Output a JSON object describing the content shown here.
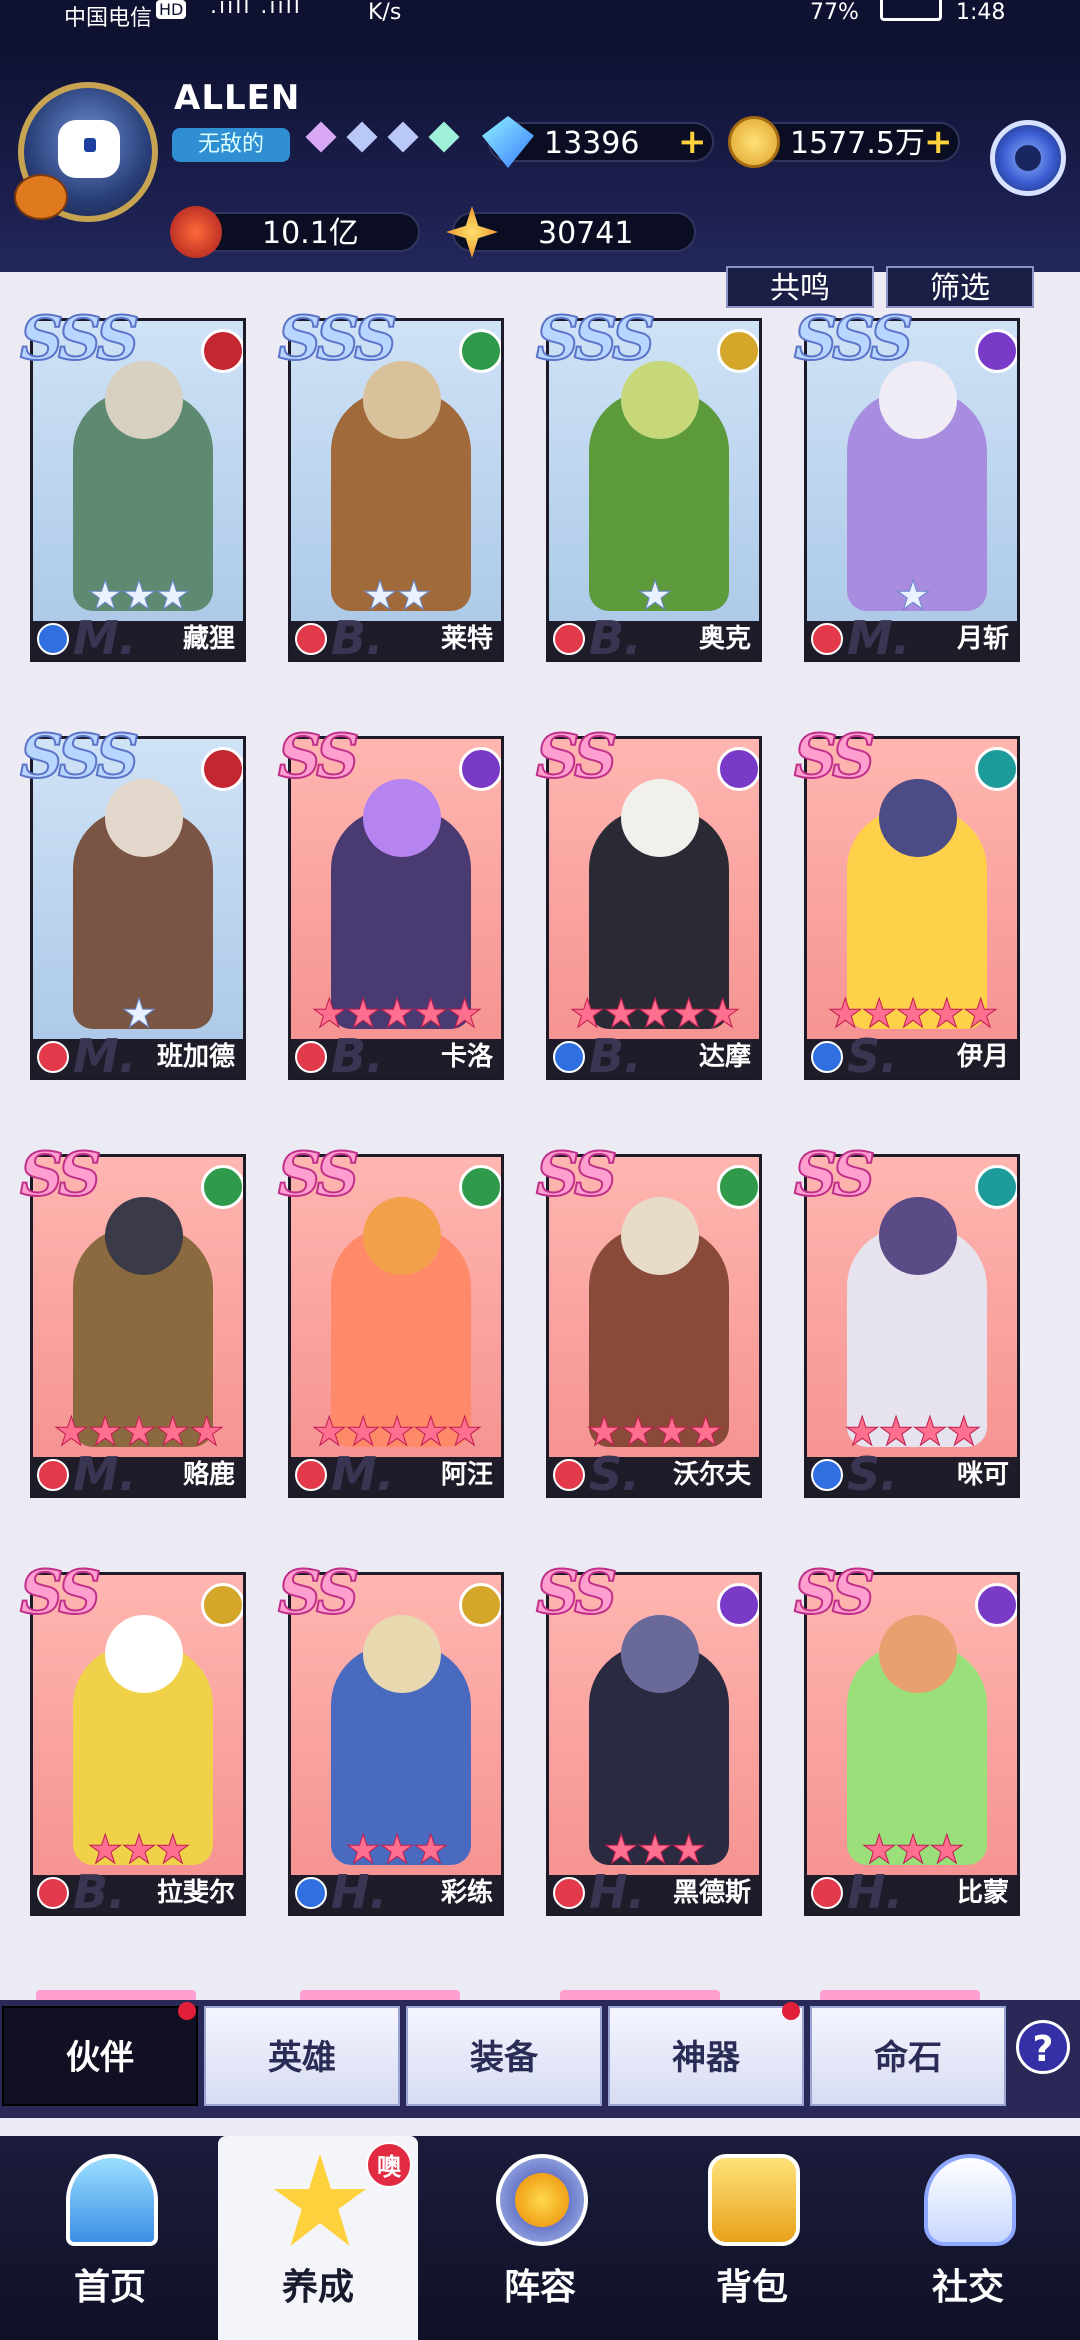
{
  "status_bar": {
    "carrier": "中国电信",
    "hd": "HD",
    "signal": ".ııll .ııll",
    "netspeed": "K/s",
    "battery": "77%",
    "time": "1:48"
  },
  "player": {
    "name": "ALLEN",
    "title": "无敌的"
  },
  "currency": {
    "diamonds": "13396",
    "gold": "1577.5万",
    "power": "10.1亿",
    "stardust": "30741"
  },
  "filters": {
    "resonance": "共鸣",
    "filter": "筛选"
  },
  "colors": {
    "accent": "#2f8fd2",
    "gold": "#ffd23d",
    "nav_bg": "#1b1c3c",
    "alert": "#e22a43"
  },
  "heroes": [
    {
      "name": "藏狸",
      "rank": "SSS",
      "stars": 3,
      "star_type": "white",
      "faction": "fire",
      "class": "M.",
      "role": "heart",
      "palette": [
        "#5f8a72",
        "#d8d0c0"
      ]
    },
    {
      "name": "莱特",
      "rank": "SSS",
      "stars": 2,
      "star_type": "white",
      "faction": "nature",
      "class": "B.",
      "role": "sword",
      "palette": [
        "#a06a3a",
        "#d9c29b"
      ]
    },
    {
      "name": "奥克",
      "rank": "SSS",
      "stars": 1,
      "star_type": "white",
      "faction": "light",
      "class": "B.",
      "role": "shield",
      "palette": [
        "#5d9a3b",
        "#c6d87a"
      ]
    },
    {
      "name": "月斩",
      "rank": "SSS",
      "stars": 1,
      "star_type": "white",
      "faction": "moon",
      "class": "M.",
      "role": "sword",
      "palette": [
        "#a88ce0",
        "#f0ecf6"
      ]
    },
    {
      "name": "班加德",
      "rank": "SSS",
      "stars": 1,
      "star_type": "white",
      "faction": "fire",
      "class": "M.",
      "role": "sword",
      "palette": [
        "#7b5543",
        "#e4d8cc"
      ]
    },
    {
      "name": "卡洛",
      "rank": "SS",
      "stars": 5,
      "star_type": "pink",
      "faction": "moon",
      "class": "B.",
      "role": "sword",
      "palette": [
        "#4a3a72",
        "#b684f0"
      ]
    },
    {
      "name": "达摩",
      "rank": "SS",
      "stars": 5,
      "star_type": "pink",
      "faction": "moon",
      "class": "B.",
      "role": "wand",
      "palette": [
        "#2a2a35",
        "#f2f0ec"
      ]
    },
    {
      "name": "伊月",
      "rank": "SS",
      "stars": 5,
      "star_type": "pink",
      "faction": "water",
      "class": "S.",
      "role": "heart",
      "palette": [
        "#ffd04a",
        "#4b4b86"
      ]
    },
    {
      "name": "赂鹿",
      "rank": "SS",
      "stars": 5,
      "star_type": "pink",
      "faction": "nature",
      "class": "M.",
      "role": "sword",
      "palette": [
        "#8a6a3e",
        "#3a3a48"
      ]
    },
    {
      "name": "阿汪",
      "rank": "SS",
      "stars": 5,
      "star_type": "pink",
      "faction": "nature",
      "class": "M.",
      "role": "shield",
      "palette": [
        "#ff8a6a",
        "#f2a04a"
      ]
    },
    {
      "name": "沃尔夫",
      "rank": "SS",
      "stars": 4,
      "star_type": "pink",
      "faction": "nature",
      "class": "S.",
      "role": "sword",
      "palette": [
        "#8a4a3a",
        "#e8dcc8"
      ]
    },
    {
      "name": "咪可",
      "rank": "SS",
      "stars": 4,
      "star_type": "pink",
      "faction": "water",
      "class": "S.",
      "role": "wand",
      "palette": [
        "#e6e2ee",
        "#5a4a86"
      ]
    },
    {
      "name": "拉斐尔",
      "rank": "SS",
      "stars": 3,
      "star_type": "pink",
      "faction": "light",
      "class": "B.",
      "role": "sword",
      "palette": [
        "#f0d24a",
        "#ffffff"
      ]
    },
    {
      "name": "彩练",
      "rank": "SS",
      "stars": 3,
      "star_type": "pink",
      "faction": "light",
      "class": "H.",
      "role": "wand",
      "palette": [
        "#4a6ac0",
        "#e8d8b0"
      ]
    },
    {
      "name": "黑德斯",
      "rank": "SS",
      "stars": 3,
      "star_type": "pink",
      "faction": "moon",
      "class": "H.",
      "role": "sword",
      "palette": [
        "#2a2a40",
        "#6a6a9a"
      ]
    },
    {
      "name": "比蒙",
      "rank": "SS",
      "stars": 3,
      "star_type": "pink",
      "faction": "moon",
      "class": "H.",
      "role": "shield",
      "palette": [
        "#9adf7a",
        "#e9a070"
      ]
    }
  ],
  "subtabs": [
    "伙伴",
    "英雄",
    "装备",
    "神器",
    "命石"
  ],
  "help": "?",
  "nav": [
    {
      "label": "首页",
      "icon": "home-icon"
    },
    {
      "label": "养成",
      "icon": "nurture-star-icon",
      "badge": "噢"
    },
    {
      "label": "阵容",
      "icon": "formation-icon"
    },
    {
      "label": "背包",
      "icon": "backpack-icon"
    },
    {
      "label": "社交",
      "icon": "social-ghost-icon"
    }
  ]
}
